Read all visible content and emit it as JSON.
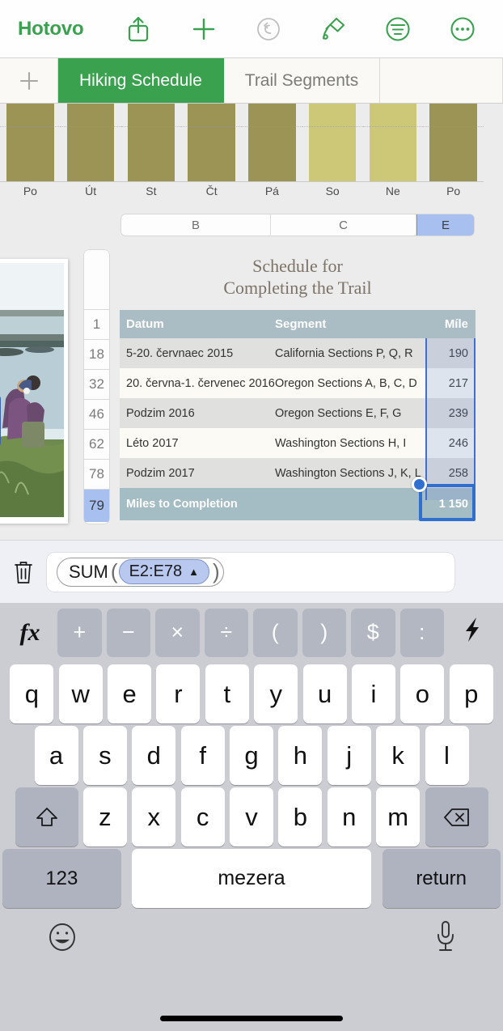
{
  "toolbar": {
    "done_label": "Hotovo",
    "accent_color": "#3aa14f",
    "icons": [
      {
        "name": "share-icon",
        "glyph": "share"
      },
      {
        "name": "insert-icon",
        "glyph": "plus"
      },
      {
        "name": "undo-icon",
        "glyph": "undo"
      },
      {
        "name": "paintbrush-icon",
        "glyph": "brush"
      },
      {
        "name": "format-icon",
        "glyph": "format"
      },
      {
        "name": "more-icon",
        "glyph": "ellipsis"
      }
    ]
  },
  "tabs": {
    "add_label": "+",
    "items": [
      {
        "label": "Hiking Schedule",
        "active": true
      },
      {
        "label": "Trail Segments",
        "active": false
      }
    ]
  },
  "chart_data": {
    "type": "bar",
    "title": "",
    "xlabel": "",
    "ylabel": "",
    "categories": [
      "Po",
      "Út",
      "St",
      "Čt",
      "Pá",
      "So",
      "Ne",
      "Po"
    ],
    "values": [
      100,
      100,
      100,
      100,
      100,
      100,
      100,
      100
    ],
    "colors": [
      "#9b9455",
      "#9b9455",
      "#9b9455",
      "#9b9455",
      "#9b9455",
      "#ccc878",
      "#ccc878",
      "#9b9455"
    ],
    "ylim": [
      0,
      100
    ],
    "grid": true,
    "legend": "none"
  },
  "column_headers": {
    "items": [
      {
        "label": "B",
        "selected": false
      },
      {
        "label": "C",
        "selected": false
      },
      {
        "label": "E",
        "selected": true
      }
    ],
    "selected_color": "#a8c0f0"
  },
  "row_gutter": {
    "rows": [
      {
        "label": "",
        "selected": false
      },
      {
        "label": "1",
        "selected": false
      },
      {
        "label": "18",
        "selected": false
      },
      {
        "label": "32",
        "selected": false
      },
      {
        "label": "46",
        "selected": false
      },
      {
        "label": "62",
        "selected": false
      },
      {
        "label": "78",
        "selected": false
      },
      {
        "label": "79",
        "selected": true
      }
    ]
  },
  "table": {
    "title_line1": "Schedule for",
    "title_line2": "Completing the Trail",
    "title_color": "#7c7266",
    "header_color": "#aabcc4",
    "columns": [
      "Datum",
      "Segment",
      "Míle"
    ],
    "rows": [
      {
        "date": "5-20. červnaec 2015",
        "segment": "California Sections P, Q, R",
        "miles": "190"
      },
      {
        "date": "20. června-1. červenec 2016",
        "segment": "Oregon Sections A, B, C, D",
        "miles": "217"
      },
      {
        "date": "Podzim 2016",
        "segment": "Oregon Sections E, F, G",
        "miles": "239"
      },
      {
        "date": "Léto 2017",
        "segment": "Washington Sections H, I",
        "miles": "246"
      },
      {
        "date": "Podzim 2017",
        "segment": "Washington Sections J, K, L",
        "miles": "258"
      }
    ],
    "footer": {
      "label": "Miles to Completion",
      "value": "1 150"
    },
    "selection_color": "#2f6fd0"
  },
  "formula_bar": {
    "trash_icon": "trash-icon",
    "function_name": "SUM",
    "open_paren": "(",
    "close_paren": ")",
    "range_token": "E2:E78",
    "range_token_arrow": "▲",
    "token_color": "#b9c8ef"
  },
  "keyboard": {
    "function_row": {
      "fx_label": "fx",
      "keys": [
        "+",
        "−",
        "×",
        "÷",
        "(",
        ")",
        "$",
        ":"
      ],
      "bolt_label": "⚡"
    },
    "row1": [
      "q",
      "w",
      "e",
      "r",
      "t",
      "y",
      "u",
      "i",
      "o",
      "p"
    ],
    "row2": [
      "a",
      "s",
      "d",
      "f",
      "g",
      "h",
      "j",
      "k",
      "l"
    ],
    "row3": [
      "z",
      "x",
      "c",
      "v",
      "b",
      "n",
      "m"
    ],
    "shift_icon": "shift-icon",
    "delete_icon": "backspace-icon",
    "numbers_label": "123",
    "space_label": "mezera",
    "return_label": "return",
    "emoji_icon": "emoji-icon",
    "dictation_icon": "microphone-icon"
  }
}
